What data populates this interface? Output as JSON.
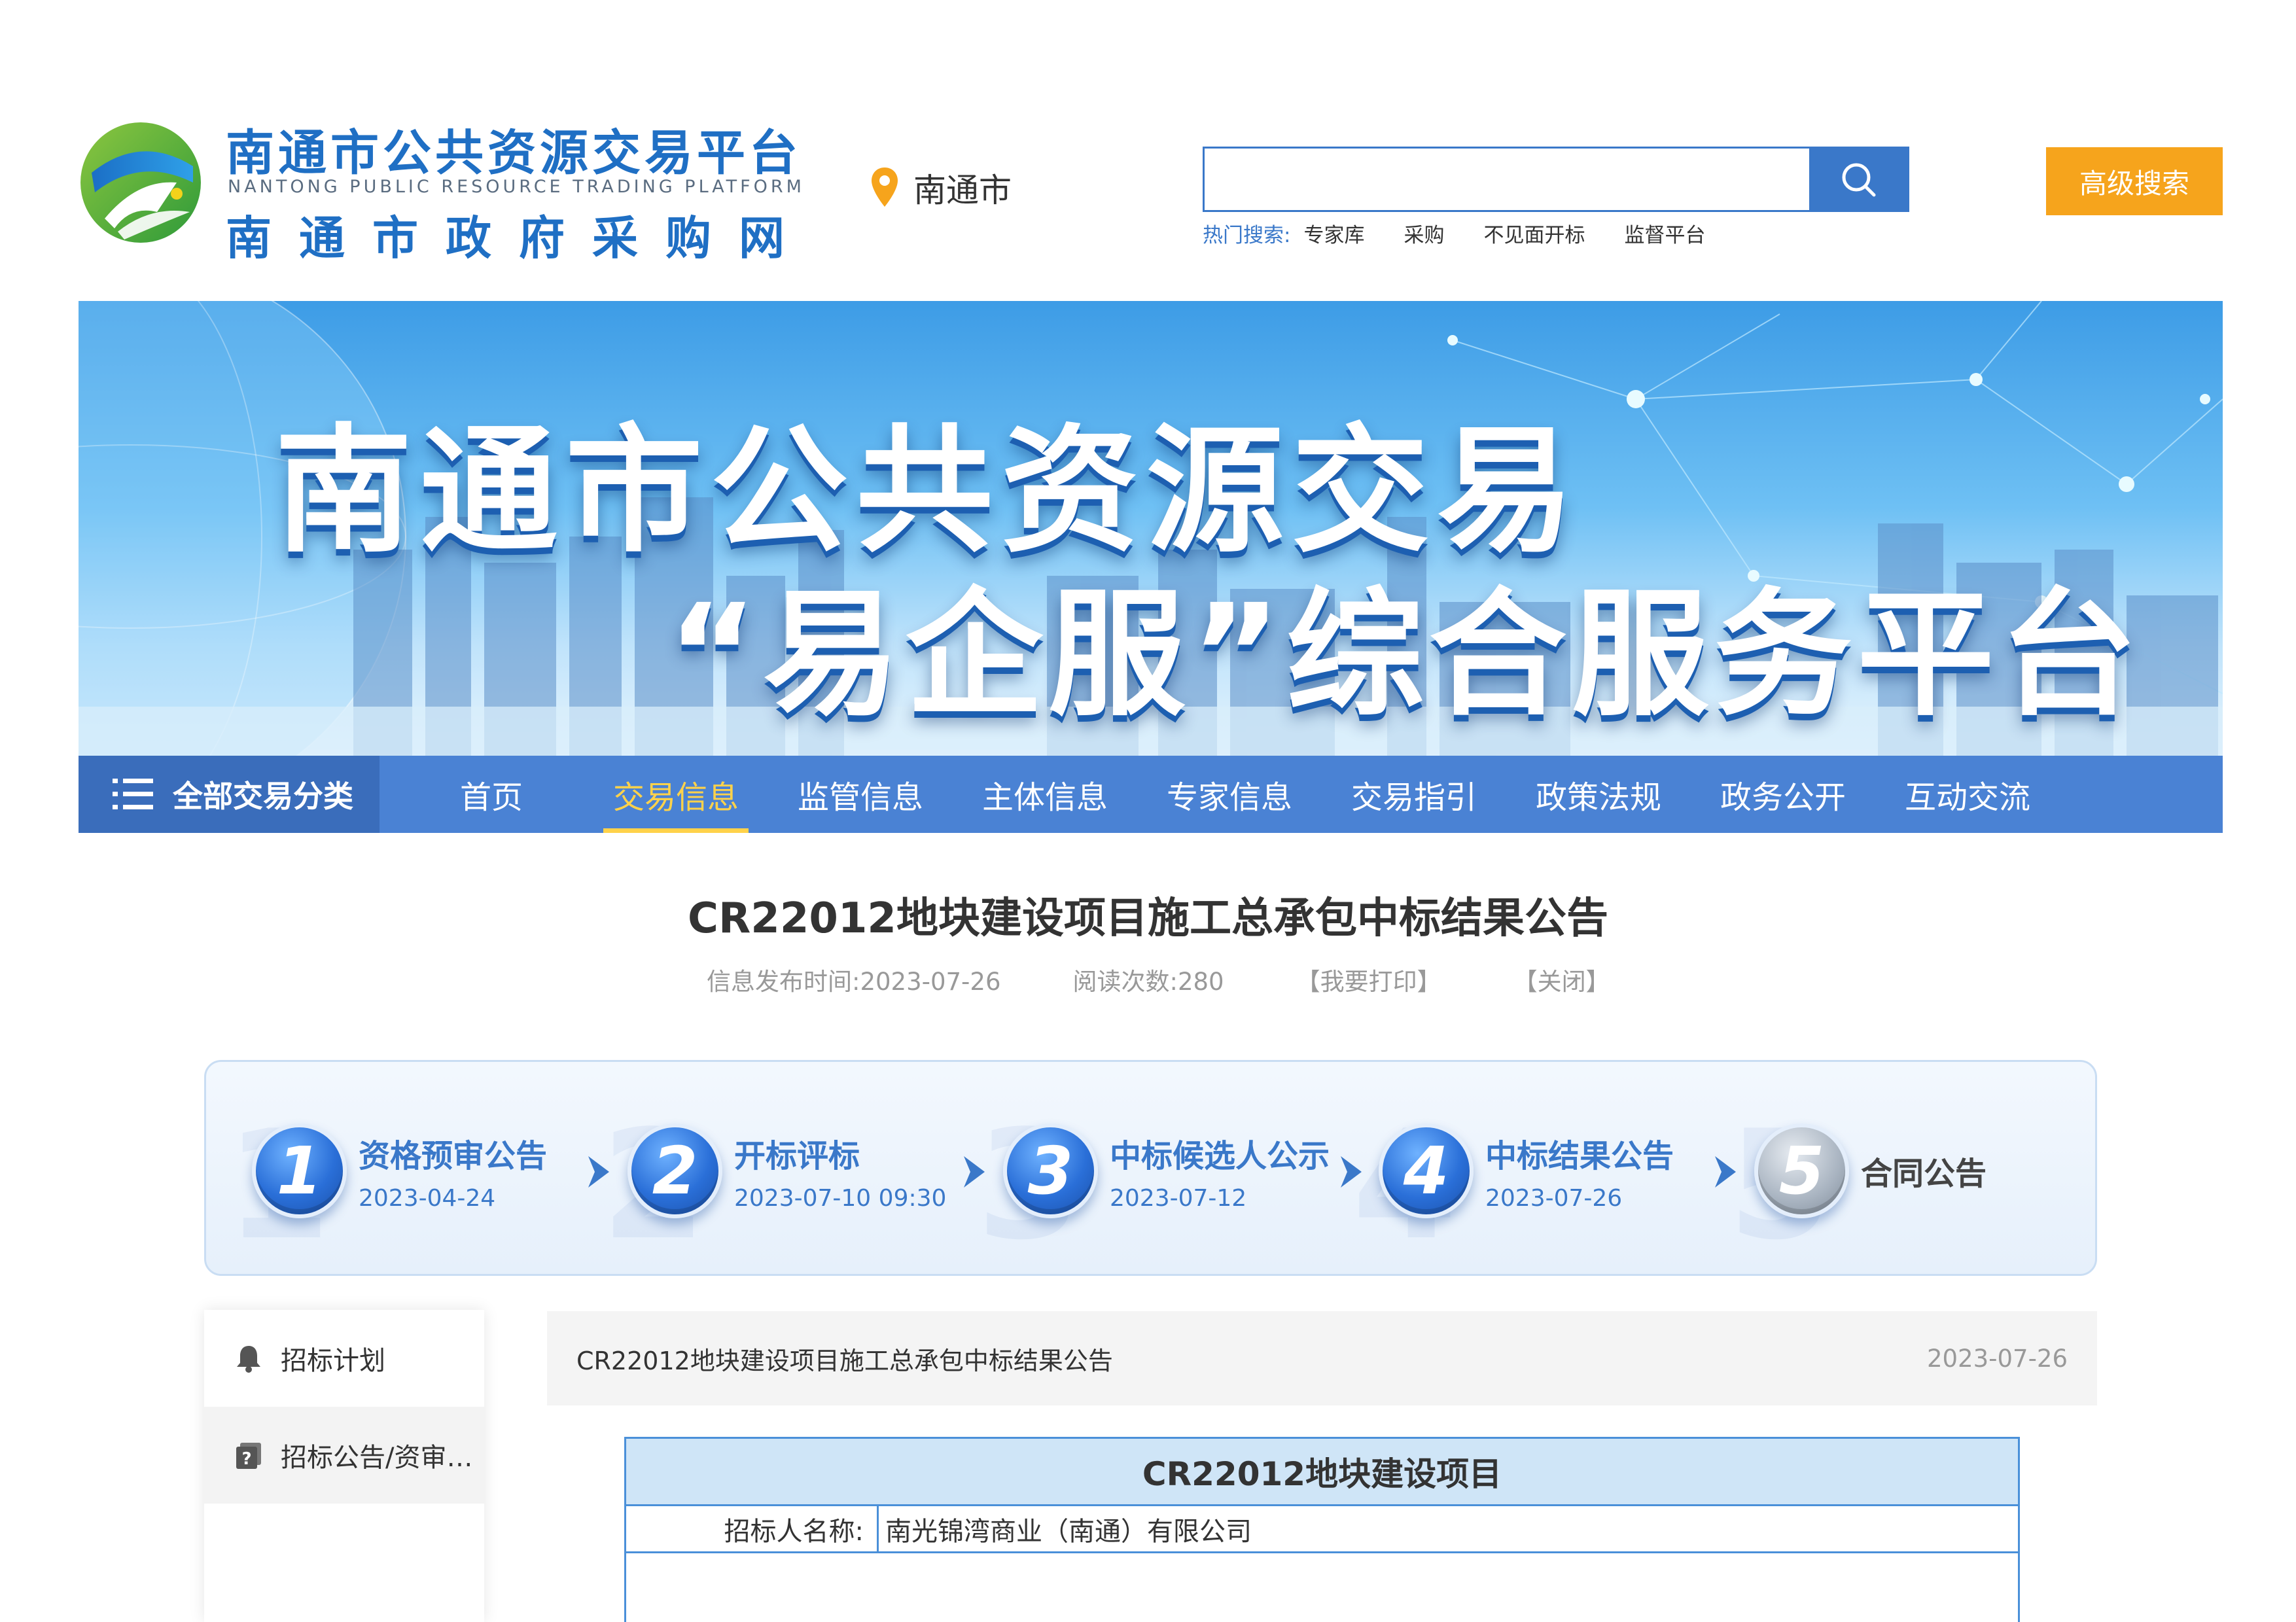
{
  "header": {
    "logo_title": "南通市公共资源交易平台",
    "logo_subtitle_en": "NANTONG PUBLIC RESOURCE TRADING PLATFORM",
    "logo_subtitle": "南通市政府采购网",
    "city": "南通市",
    "search": {
      "placeholder": "",
      "value": ""
    },
    "hot_search_label": "热门搜索:",
    "hot_search_items": [
      "专家库",
      "采购",
      "不见面开标",
      "监督平台"
    ],
    "advanced_search_label": "高级搜索"
  },
  "banner": {
    "line1": "南通市公共资源交易",
    "line2": "“易企服”综合服务平台"
  },
  "nav": {
    "all_categories_label": "全部交易分类",
    "items": [
      "首页",
      "交易信息",
      "监管信息",
      "主体信息",
      "专家信息",
      "交易指引",
      "政策法规",
      "政务公开",
      "互动交流"
    ],
    "active_index": 1
  },
  "article": {
    "title": "CR22012地块建设项目施工总承包中标结果公告",
    "publish_time": "信息发布时间:2023-07-26",
    "read_count": "阅读次数:280",
    "print_label": "【我要打印】",
    "close_label": "【关闭】"
  },
  "steps": [
    {
      "num": "1",
      "name": "资格预审公告",
      "date": "2023-04-24",
      "state": "done"
    },
    {
      "num": "2",
      "name": "开标评标",
      "date": "2023-07-10 09:30",
      "state": "done"
    },
    {
      "num": "3",
      "name": "中标候选人公示",
      "date": "2023-07-12",
      "state": "done"
    },
    {
      "num": "4",
      "name": "中标结果公告",
      "date": "2023-07-26",
      "state": "done"
    },
    {
      "num": "5",
      "name": "合同公告",
      "date": "",
      "state": "pending"
    }
  ],
  "sidebar": {
    "items": [
      {
        "label": "招标计划",
        "icon": "bell-icon"
      },
      {
        "label": "招标公告/资审…",
        "icon": "question-doc-icon"
      }
    ]
  },
  "content": {
    "bar_title": "CR22012地块建设项目施工总承包中标结果公告",
    "bar_date": "2023-07-26",
    "table_title": "CR22012地块建设项目",
    "rows": [
      {
        "label": "招标人名称:",
        "value": "南光锦湾商业（南通）有限公司"
      }
    ]
  },
  "colors": {
    "brand_blue": "#3a78c9",
    "nav_blue": "#4a82d4",
    "accent_orange": "#f6a41c",
    "active_yellow": "#ffd24a"
  }
}
